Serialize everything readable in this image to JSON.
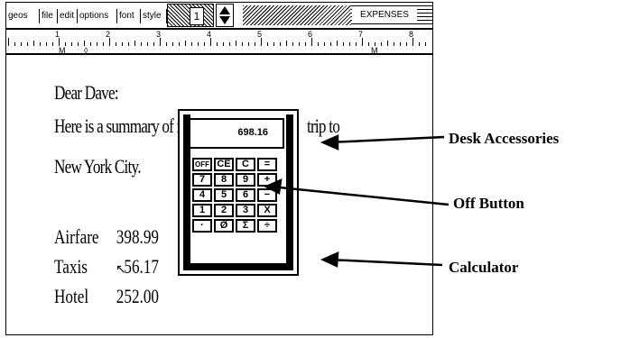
{
  "menu": {
    "geos": "geos",
    "file": "file",
    "edit": "edit",
    "options": "options",
    "font": "font",
    "style": "style"
  },
  "page_number": "1",
  "document_title": "EXPENSES",
  "ruler": {
    "numbers": [
      "1",
      "2",
      "3",
      "4",
      "5",
      "6",
      "7",
      "8"
    ],
    "left_margin": "M",
    "right_margin": "M"
  },
  "letter": {
    "line1": "Dear Dave:",
    "line2": "Here is a summary of m",
    "line2_tail": "trip to",
    "line3": "New York City."
  },
  "expenses": [
    {
      "label": "Airfare",
      "amount": "398.99"
    },
    {
      "label": "Taxis",
      "amount": "56.17"
    },
    {
      "label": "Hotel",
      "amount": "252.00"
    }
  ],
  "calculator": {
    "display": "698.16",
    "keys": [
      [
        "OFF",
        "CE",
        "C",
        "="
      ],
      [
        "7",
        "8",
        "9",
        "+"
      ],
      [
        "4",
        "5",
        "6",
        "−"
      ],
      [
        "1",
        "2",
        "3",
        "X"
      ],
      [
        "·",
        "Ø",
        "Σ",
        "÷"
      ]
    ]
  },
  "callouts": {
    "desk_accessories": "Desk Accessories",
    "off_button": "Off Button",
    "calculator": "Calculator"
  }
}
